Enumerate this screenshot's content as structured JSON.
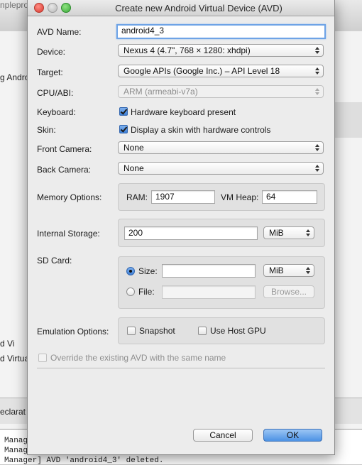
{
  "background": {
    "ide_title": "nplepro",
    "left_fragments": [
      "g Andro",
      "d Vi",
      "d Virtua"
    ],
    "declaration_tab": "eclarat",
    "console_lines": [
      "Manag",
      "Manag",
      "Manager] AVD 'android4_3' deleted."
    ]
  },
  "dialog": {
    "title": "Create new Android Virtual Device (AVD)",
    "avd_name": {
      "label": "AVD Name:",
      "value": "android4_3"
    },
    "device": {
      "label": "Device:",
      "value": "Nexus 4 (4.7\", 768 × 1280: xhdpi)"
    },
    "target": {
      "label": "Target:",
      "value": "Google APIs (Google Inc.) – API Level 18"
    },
    "cpu_abi": {
      "label": "CPU/ABI:",
      "value": "ARM (armeabi-v7a)"
    },
    "keyboard": {
      "label": "Keyboard:",
      "checkbox_label": "Hardware keyboard present",
      "checked": true
    },
    "skin": {
      "label": "Skin:",
      "checkbox_label": "Display a skin with hardware controls",
      "checked": true
    },
    "front_camera": {
      "label": "Front Camera:",
      "value": "None"
    },
    "back_camera": {
      "label": "Back Camera:",
      "value": "None"
    },
    "memory": {
      "label": "Memory Options:",
      "ram_label": "RAM:",
      "ram_value": "1907",
      "heap_label": "VM Heap:",
      "heap_value": "64"
    },
    "internal_storage": {
      "label": "Internal Storage:",
      "value": "200",
      "unit": "MiB"
    },
    "sd_card": {
      "label": "SD Card:",
      "size_label": "Size:",
      "size_value": "",
      "size_unit": "MiB",
      "file_label": "File:",
      "file_value": "",
      "browse_label": "Browse..."
    },
    "emulation": {
      "label": "Emulation Options:",
      "snapshot_label": "Snapshot",
      "gpu_label": "Use Host GPU"
    },
    "override_label": "Override the existing AVD with the same name",
    "cancel_label": "Cancel",
    "ok_label": "OK"
  }
}
